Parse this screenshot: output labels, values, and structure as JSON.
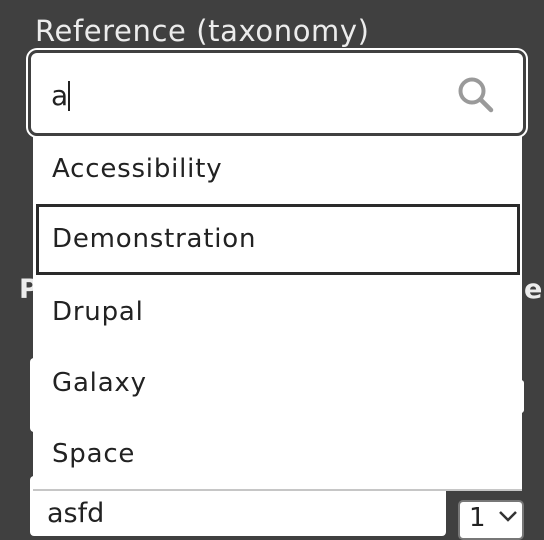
{
  "field": {
    "label": "Reference (taxonomy)"
  },
  "search": {
    "value": "a",
    "icon": "search-icon"
  },
  "autocomplete": {
    "items": [
      {
        "label": "Accessibility"
      },
      {
        "label": "Demonstration",
        "active": true
      },
      {
        "label": "Drupal"
      },
      {
        "label": "Galaxy"
      },
      {
        "label": "Space"
      }
    ]
  },
  "background": {
    "left_label_fragment": "P",
    "right_label_fragment": "er",
    "row_input_value": "asfd",
    "row_select_value": "1"
  },
  "colors": {
    "page_background": "#404040",
    "surface": "#ffffff",
    "text": "#222222",
    "label_text": "#ececec",
    "focus_outline": "#2a2a2a",
    "icon": "#9a9a9a"
  }
}
